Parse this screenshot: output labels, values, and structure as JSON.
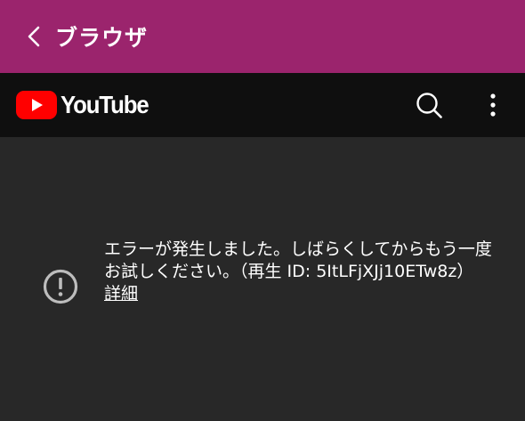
{
  "top_bar": {
    "title": "ブラウザ",
    "background": "#9b246d"
  },
  "youtube_header": {
    "logo_text": "YouTube",
    "logo_red": "#ff0000",
    "background": "#0f0f0f",
    "icons": [
      "search-icon",
      "more-vert-icon"
    ]
  },
  "error": {
    "icon": "error-outline-icon",
    "message": "エラーが発生しました。しばらくしてからもう一度お試しください。（再生 ID: 5ItLFjXJj10ETw8z）",
    "details_link": "詳細"
  }
}
